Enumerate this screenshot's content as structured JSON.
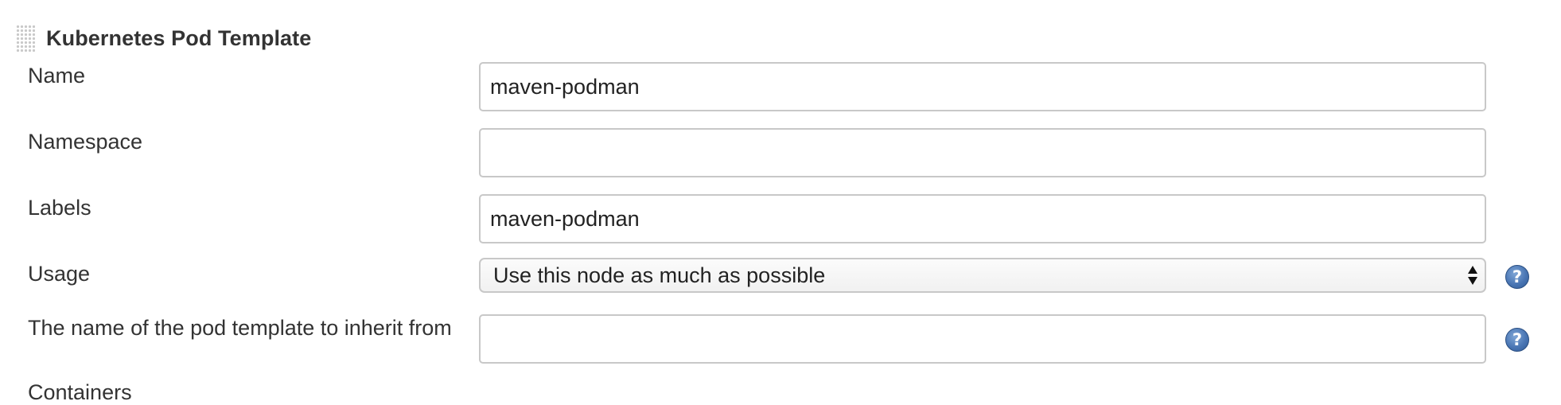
{
  "section": {
    "title": "Kubernetes Pod Template"
  },
  "fields": {
    "name": {
      "label": "Name",
      "value": "maven-podman"
    },
    "namespace": {
      "label": "Namespace",
      "value": ""
    },
    "labels": {
      "label": "Labels",
      "value": "maven-podman"
    },
    "usage": {
      "label": "Usage",
      "selected": "Use this node as much as possible"
    },
    "inherit_from": {
      "label": "The name of the pod template to inherit from",
      "value": ""
    }
  },
  "next_section_partial_label": "Containers",
  "help_icon_glyph": "?",
  "icons": [
    "drag-handle-icon",
    "help-icon",
    "select-arrows-icon"
  ],
  "colors": {
    "text": "#333333",
    "border": "#c8c8c8",
    "help_blue": "#4a76b4"
  }
}
